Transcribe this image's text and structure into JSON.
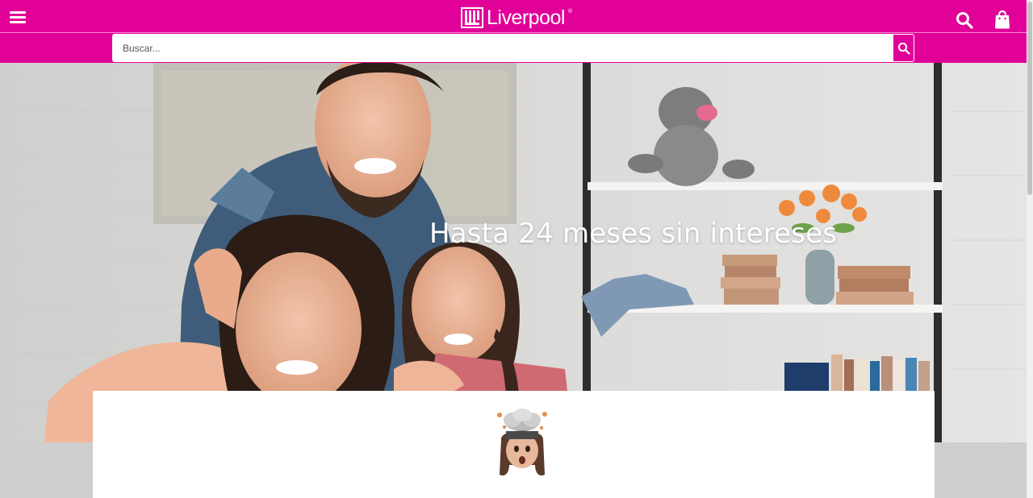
{
  "header": {
    "brand": "Liverpool",
    "brand_mark": "®",
    "menu_icon": "hamburger-menu-icon",
    "search_icon": "search-icon",
    "cart_icon": "shopping-bag-icon",
    "background_color": "#e10098"
  },
  "search": {
    "placeholder": "Buscar...",
    "value": "",
    "submit_icon": "search-icon"
  },
  "hero": {
    "title": "Hasta 24 meses sin intereses"
  },
  "card": {
    "avatar_icon": "mind-blown-memoji-icon"
  },
  "colors": {
    "brand_pink": "#e10098",
    "band_gray": "#cfcfcf",
    "white": "#ffffff"
  }
}
